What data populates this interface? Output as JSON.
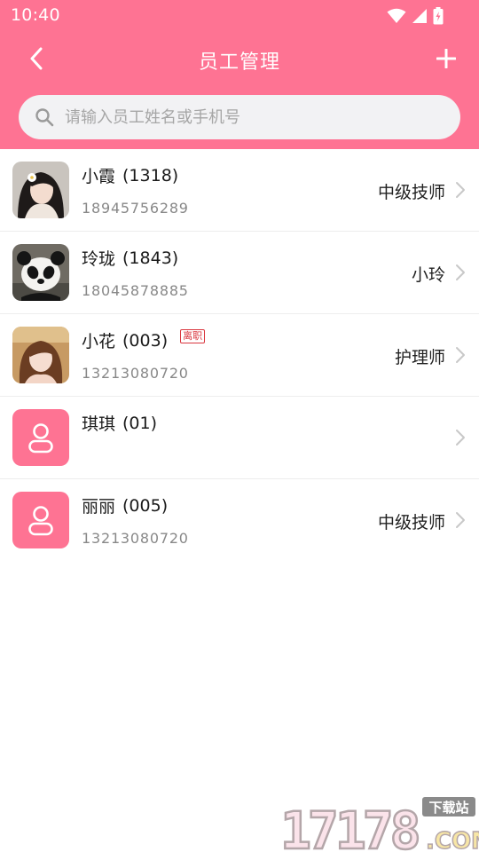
{
  "status_bar": {
    "time": "10:40",
    "icons": [
      "wifi-icon",
      "signal-icon",
      "battery-charging-icon"
    ]
  },
  "nav": {
    "back_icon": "chevron-left-icon",
    "title": "员工管理",
    "add_icon": "plus-icon"
  },
  "search": {
    "placeholder": "请输入员工姓名或手机号",
    "value": "",
    "icon": "search-icon"
  },
  "employees": [
    {
      "name": "小霞",
      "code": "(1318)",
      "phone": "18945756289",
      "role": "中级技师",
      "badge": "",
      "avatar": "photo-woman-flower"
    },
    {
      "name": "玲珑",
      "code": "(1843)",
      "phone": "18045878885",
      "role": "小玲",
      "badge": "",
      "avatar": "photo-panda"
    },
    {
      "name": "小花",
      "code": "(003)",
      "phone": "13213080720",
      "role": "护理师",
      "badge": "离职",
      "avatar": "photo-woman"
    },
    {
      "name": "琪琪",
      "code": "(01)",
      "phone": "",
      "role": "",
      "badge": "",
      "avatar": "default-user-icon"
    },
    {
      "name": "丽丽",
      "code": "(005)",
      "phone": "13213080720",
      "role": "中级技师",
      "badge": "",
      "avatar": "default-user-icon"
    }
  ],
  "watermark": {
    "number": "17178",
    "domain": ".COM",
    "tag": "下载站"
  },
  "colors": {
    "header": "#fe7393",
    "search_bg": "#f2f2f4",
    "placeholder": "#a6a6a6",
    "badge": "#d9363e",
    "default_avatar": "#fe7393"
  }
}
